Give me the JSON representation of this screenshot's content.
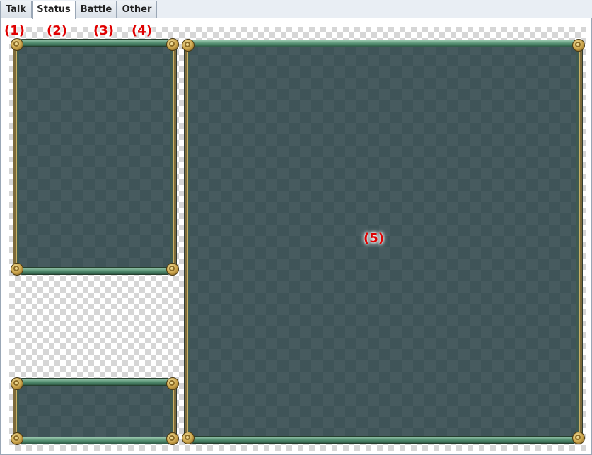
{
  "tabs": [
    {
      "label": "Talk",
      "active": false
    },
    {
      "label": "Status",
      "active": true
    },
    {
      "label": "Battle",
      "active": false
    },
    {
      "label": "Other",
      "active": false
    }
  ],
  "callouts": [
    "(1)",
    "(2)",
    "(3)",
    "(4)",
    "(5)"
  ],
  "colors": {
    "callout": "#e00000",
    "window_fill": "#3f5458",
    "frame_bar": "#4f8a6d",
    "frame_gold": "#c8a046"
  }
}
